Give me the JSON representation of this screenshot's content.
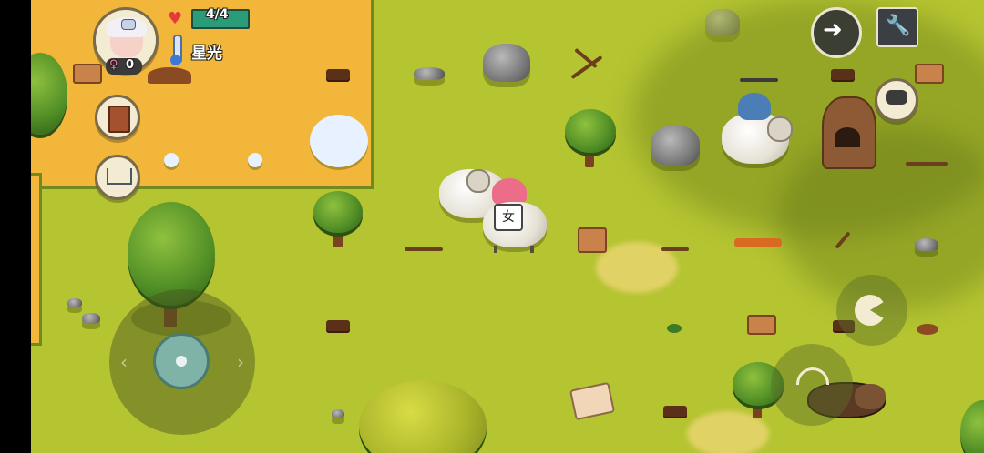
{
  "status": {
    "health_text": "4/4",
    "player_name": "星光",
    "female_count": "0",
    "gender_symbol": "♀"
  },
  "speech_bubble": {
    "text": "女"
  },
  "colors": {
    "grass": "#b5c431",
    "sand": "#f2b73a",
    "health_bar": "#2a9c7a"
  },
  "icons": {
    "arrow": "arrow-right-icon",
    "settings": "wrench-icon",
    "chat": "chat-bubble-icon",
    "book": "book-icon",
    "shop": "shopping-cart-icon",
    "heart": "heart-icon",
    "thermometer": "thermometer-icon",
    "eat": "eat-icon",
    "pickup": "pickup-icon"
  }
}
